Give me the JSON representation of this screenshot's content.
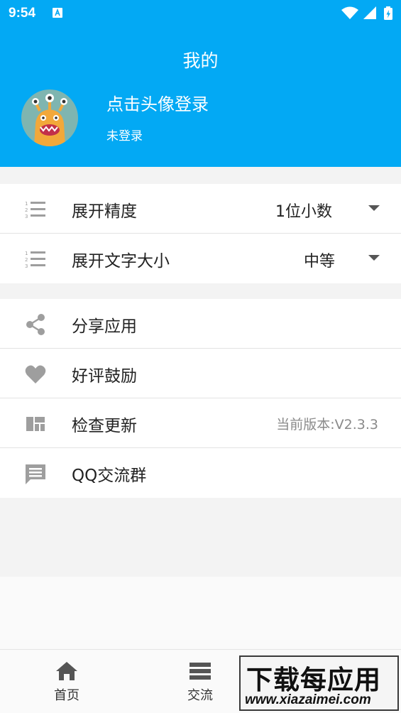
{
  "status_bar": {
    "time": "9:54"
  },
  "header": {
    "title": "我的",
    "login_title": "点击头像登录",
    "login_status": "未登录"
  },
  "settings": [
    {
      "icon": "numbered-list-icon",
      "label": "展开精度",
      "value": "1位小数"
    },
    {
      "icon": "numbered-list-icon",
      "label": "展开文字大小",
      "value": "中等"
    }
  ],
  "menu": [
    {
      "icon": "share-icon",
      "label": "分享应用"
    },
    {
      "icon": "heart-icon",
      "label": "好评鼓励"
    },
    {
      "icon": "dashboard-icon",
      "label": "检查更新",
      "value": "当前版本:V2.3.3"
    },
    {
      "icon": "chat-icon",
      "label": "QQ交流群"
    }
  ],
  "bottom_nav": [
    {
      "icon": "home-icon",
      "label": "首页"
    },
    {
      "icon": "list-icon",
      "label": "交流"
    }
  ],
  "watermark": {
    "title": "下载每应用",
    "url": "www.xiazaimei.com"
  },
  "colors": {
    "primary": "#03a9f4",
    "icon_gray": "#9e9e9e"
  }
}
